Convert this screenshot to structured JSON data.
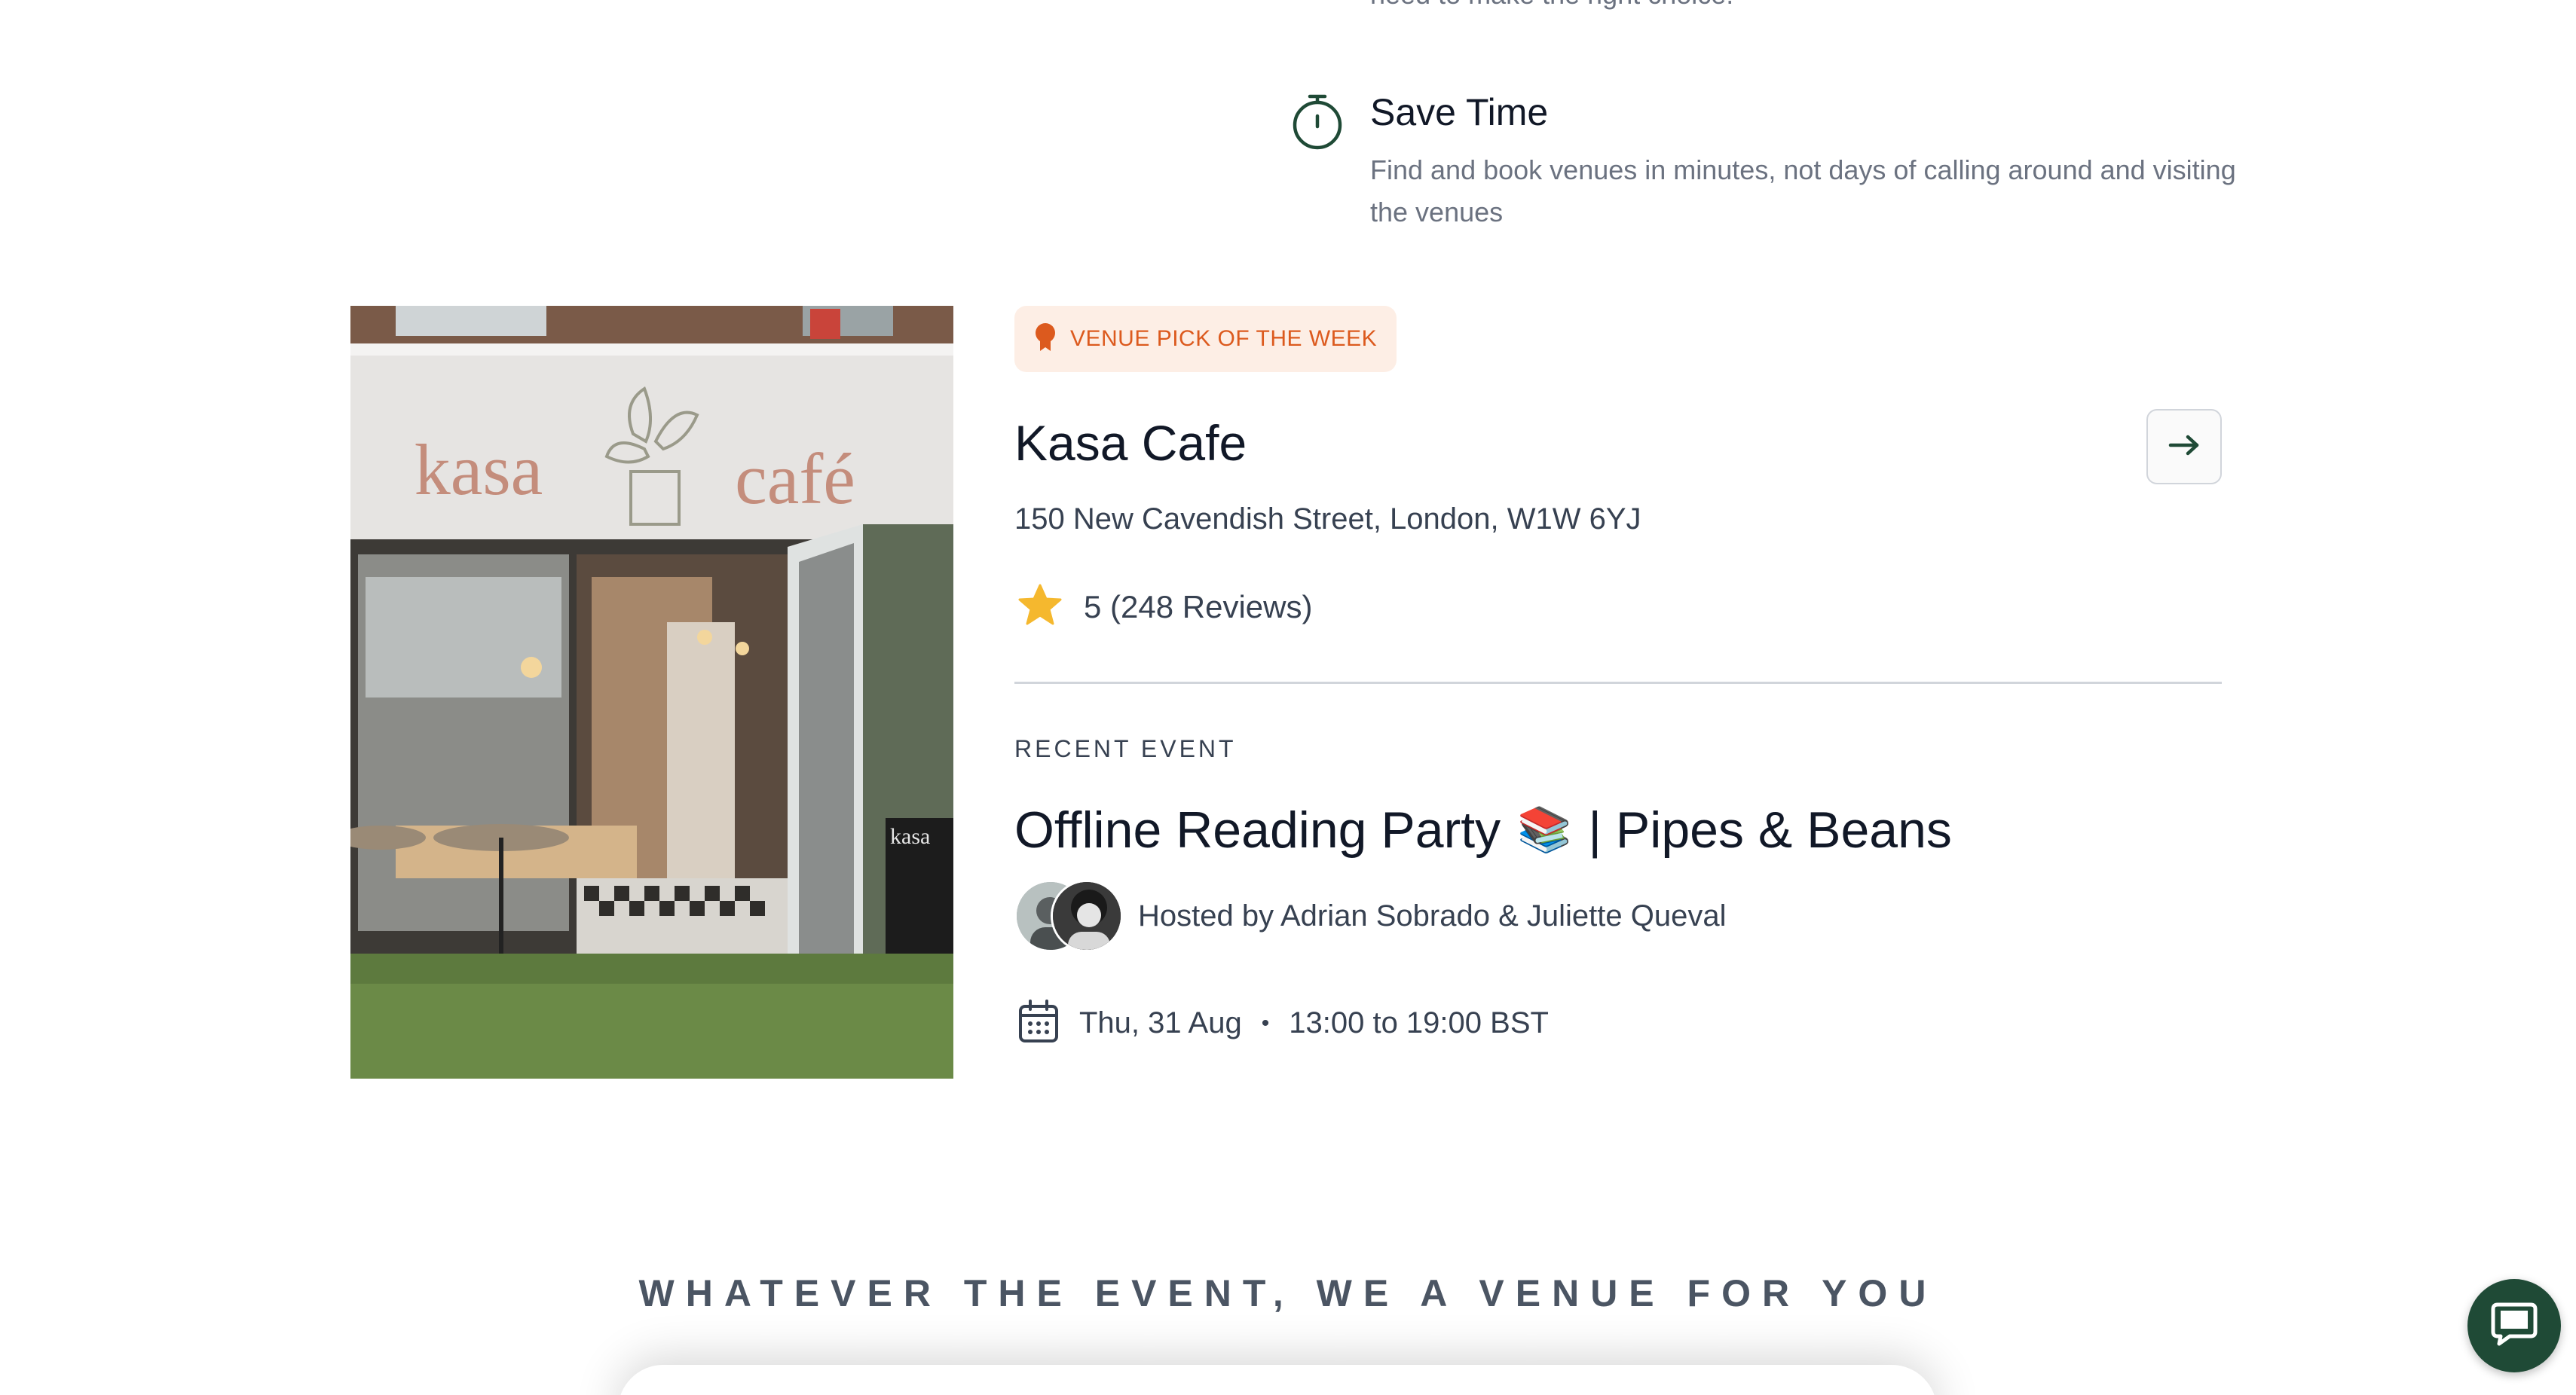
{
  "features": {
    "cut_text": "need to make the right choice.",
    "save_time": {
      "title": "Save Time",
      "description": "Find and book venues in minutes, not days of calling around and visiting the venues",
      "icon": "stopwatch-icon"
    }
  },
  "venue": {
    "badge": "VENUE PICK OF THE WEEK",
    "badge_icon": "award-ribbon-icon",
    "name": "Kasa Cafe",
    "address": "150 New Cavendish Street, London, W1W 6YJ",
    "rating": "5 (248 Reviews)",
    "rating_icon": "star-icon",
    "image": {
      "sign_left": "kasa",
      "sign_right": "café",
      "board_text": "kasa"
    },
    "arrow_icon": "arrow-right-icon"
  },
  "recent_event": {
    "label": "RECENT EVENT",
    "title_part1": "Offline Reading Party",
    "title_emoji": "📚",
    "title_part2": "| Pipes & Beans",
    "hosts": "Hosted by Adrian Sobrado & Juliette Queval",
    "date": "Thu, 31 Aug",
    "separator": "•",
    "time": "13:00 to 19:00 BST",
    "date_icon": "calendar-icon"
  },
  "tagline": "WHATEVER THE EVENT, WE A VENUE FOR YOU",
  "chat": {
    "icon": "chat-bubble-icon"
  },
  "colors": {
    "brand_green": "#1f4a36",
    "badge_bg": "#fdeee5",
    "badge_text": "#dc5a1e",
    "star": "#f5b82e"
  }
}
